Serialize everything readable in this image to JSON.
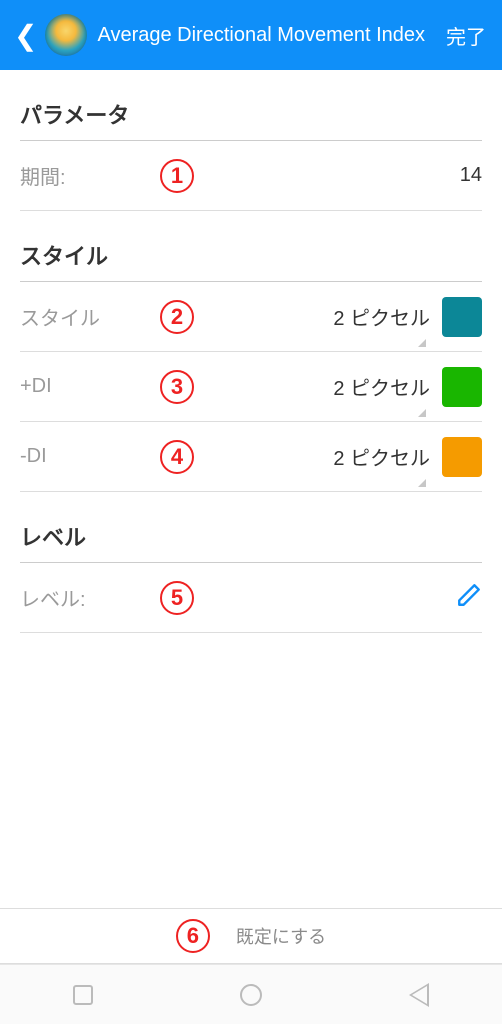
{
  "header": {
    "title": "Average Directional Movement Index",
    "done": "完了"
  },
  "sections": {
    "parameters": {
      "title": "パラメータ",
      "period_label": "期間:",
      "period_value": "14"
    },
    "style": {
      "title": "スタイル",
      "rows": [
        {
          "label": "スタイル",
          "pixel": "2 ピクセル",
          "color": "#0c8797"
        },
        {
          "label": "+DI",
          "pixel": "2 ピクセル",
          "color": "#19b600"
        },
        {
          "label": "-DI",
          "pixel": "2 ピクセル",
          "color": "#f59b00"
        }
      ]
    },
    "level": {
      "title": "レベル",
      "label": "レベル:"
    }
  },
  "footer": {
    "reset_label": "既定にする"
  },
  "badges": [
    "1",
    "2",
    "3",
    "4",
    "5",
    "6"
  ]
}
